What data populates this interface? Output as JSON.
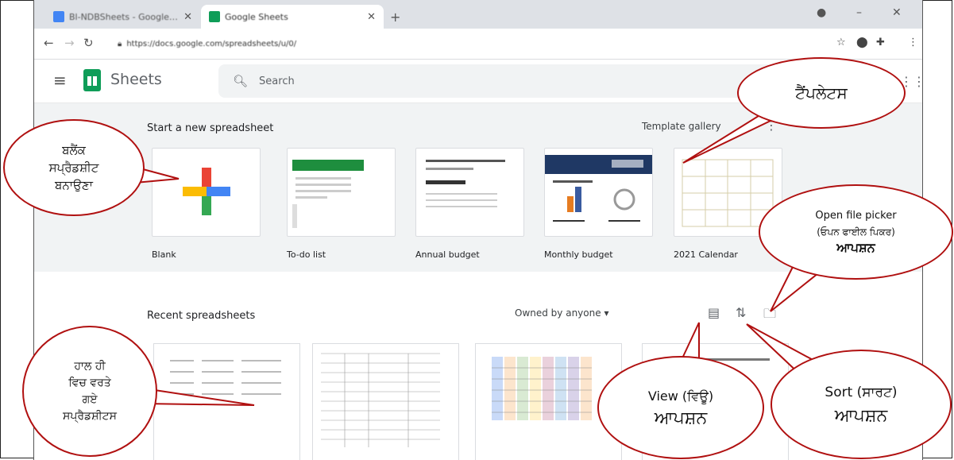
{
  "browser": {
    "tabs": [
      {
        "title": "Bl-NDBSheets - Google Sheets",
        "active": false,
        "color": "#4285f4"
      },
      {
        "title": "Google Sheets",
        "active": true,
        "color": "#0f9d58"
      }
    ],
    "url": "https://docs.google.com/spreadsheets/u/0/"
  },
  "app": {
    "name": "Sheets",
    "search_placeholder": "Search"
  },
  "templates": {
    "section_title": "Start a new spreadsheet",
    "gallery_label": "Template gallery",
    "items": [
      {
        "label": "Blank"
      },
      {
        "label": "To-do list"
      },
      {
        "label": "Annual budget"
      },
      {
        "label": "Monthly budget"
      },
      {
        "label": "2021 Calendar"
      }
    ]
  },
  "recent": {
    "section_title": "Recent spreadsheets",
    "owner_filter": "Owned by anyone"
  },
  "callouts": {
    "blank": [
      "ਬਲੈਂਕ",
      "ਸਪ੍ਰੈਡਸ਼ੀਟ",
      "ਬਨਾਉਣਾ"
    ],
    "templates": "ਟੈਂਪਲੇਟਸ",
    "open_picker": [
      "Open file picker",
      "(ਓਪਨ ਫਾਈਲ ਪਿਕਰ)",
      "ਆਪਸ਼ਨ"
    ],
    "recent": [
      "ਹਾਲ ਹੀ",
      "ਵਿਚ ਵਰਤੇ",
      "ਗਏ",
      "ਸਪ੍ਰੈਡਸ਼ੀਟਸ"
    ],
    "view": [
      "View (ਵਿਊ)",
      "ਆਪਸ਼ਨ"
    ],
    "sort": [
      "Sort (ਸਾਰਟ)",
      "ਆਪਸ਼ਨ"
    ]
  },
  "colors": {
    "callout_border": "#b01010",
    "sheets_green": "#0f9d58",
    "template_bg": "#f1f3f4"
  }
}
